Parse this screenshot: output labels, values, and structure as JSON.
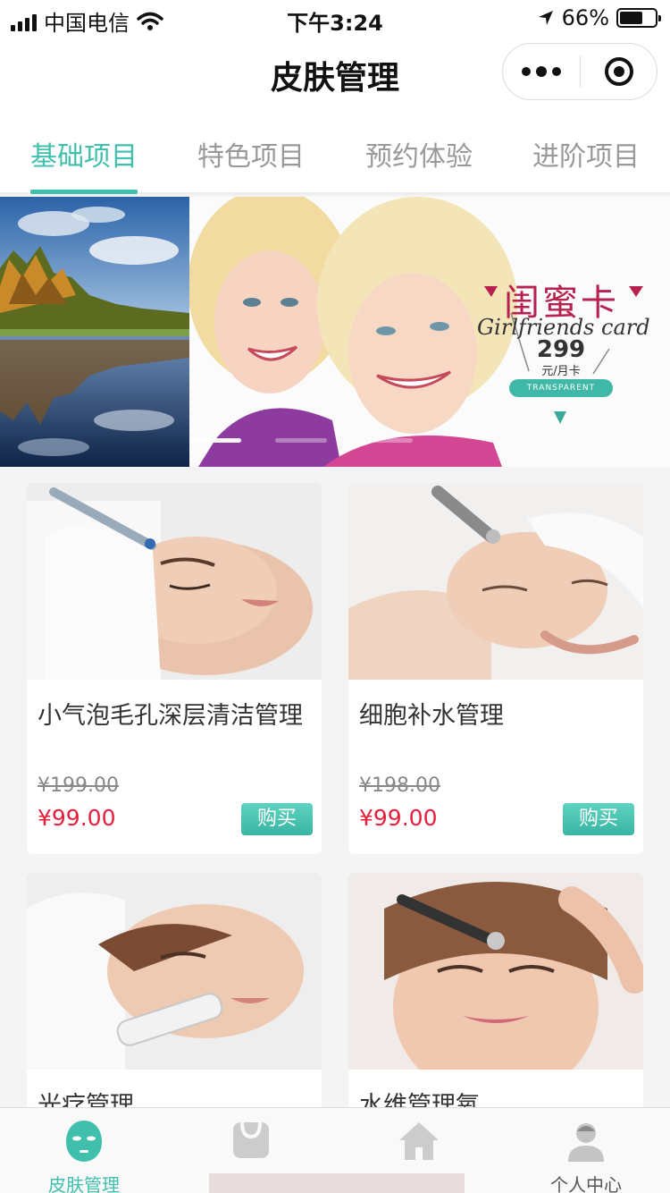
{
  "status_bar": {
    "carrier": "中国电信",
    "time": "下午3:24",
    "battery": "66%",
    "battery_level": 0.66
  },
  "nav": {
    "title": "皮肤管理",
    "more_icon": "more-dots-icon",
    "close_icon": "target-close-icon"
  },
  "tabs": [
    {
      "label": "基础项目",
      "active": true
    },
    {
      "label": "特色项目",
      "active": false
    },
    {
      "label": "预约体验",
      "active": false
    },
    {
      "label": "进阶项目",
      "active": false
    }
  ],
  "banner": {
    "promo_title": "闺蜜卡",
    "promo_subtitle": "Girlfriends card",
    "promo_price": "299",
    "promo_unit": "元/月卡",
    "promo_tag": "TRANSPARENT",
    "slide_count": 3,
    "active_slide": 1
  },
  "products": [
    {
      "name": "小气泡毛孔深层清洁管理",
      "original_price": "¥199.00",
      "price": "¥99.00",
      "buy_label": "购买"
    },
    {
      "name": "细胞补水管理",
      "original_price": "¥198.00",
      "price": "¥99.00",
      "buy_label": "购买"
    },
    {
      "name": "光疗管理",
      "original_price": "",
      "price": "",
      "buy_label": ""
    },
    {
      "name": "水维管理氧",
      "original_price": "",
      "price": "",
      "buy_label": ""
    }
  ],
  "tabbar": [
    {
      "label": "皮肤管理",
      "icon": "face-mask-icon",
      "active": true
    },
    {
      "label": "",
      "icon": "shopping-bag-icon",
      "active": false
    },
    {
      "label": "",
      "icon": "home-icon",
      "active": false
    },
    {
      "label": "个人中心",
      "icon": "user-icon",
      "active": false
    }
  ],
  "colors": {
    "accent": "#3fbfac",
    "price": "#e4203c",
    "inactive": "#999999"
  }
}
